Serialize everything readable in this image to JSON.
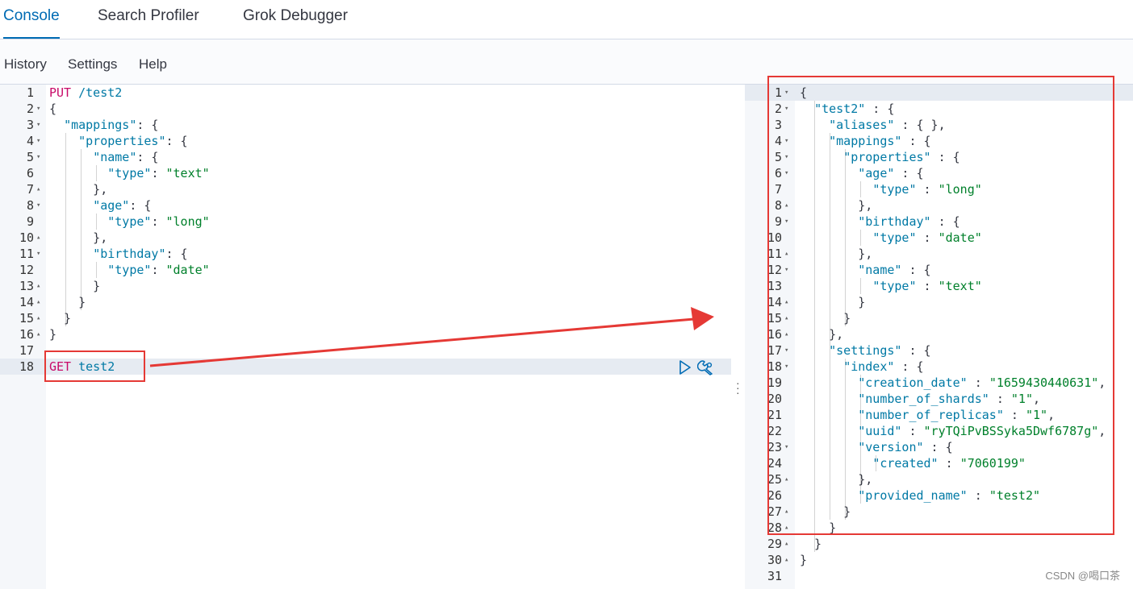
{
  "tabs": [
    {
      "label": "Console",
      "active": true
    },
    {
      "label": "Search Profiler",
      "active": false
    },
    {
      "label": "Grok Debugger",
      "active": false
    }
  ],
  "menu": {
    "history": "History",
    "settings": "Settings",
    "help": "Help"
  },
  "request": {
    "lines": [
      [
        [
          "kw",
          "PUT"
        ],
        [
          "pun",
          " "
        ],
        [
          "path",
          "/test2"
        ]
      ],
      [
        [
          "pun",
          "{"
        ]
      ],
      [
        [
          "pun",
          "  "
        ],
        [
          "key",
          "\"mappings\""
        ],
        [
          "pun",
          ": {"
        ]
      ],
      [
        [
          "pun",
          "    "
        ],
        [
          "key",
          "\"properties\""
        ],
        [
          "pun",
          ": {"
        ]
      ],
      [
        [
          "pun",
          "      "
        ],
        [
          "key",
          "\"name\""
        ],
        [
          "pun",
          ": {"
        ]
      ],
      [
        [
          "pun",
          "        "
        ],
        [
          "key",
          "\"type\""
        ],
        [
          "pun",
          ": "
        ],
        [
          "str",
          "\"text\""
        ]
      ],
      [
        [
          "pun",
          "      },"
        ]
      ],
      [
        [
          "pun",
          "      "
        ],
        [
          "key",
          "\"age\""
        ],
        [
          "pun",
          ": {"
        ]
      ],
      [
        [
          "pun",
          "        "
        ],
        [
          "key",
          "\"type\""
        ],
        [
          "pun",
          ": "
        ],
        [
          "str",
          "\"long\""
        ]
      ],
      [
        [
          "pun",
          "      },"
        ]
      ],
      [
        [
          "pun",
          "      "
        ],
        [
          "key",
          "\"birthday\""
        ],
        [
          "pun",
          ": {"
        ]
      ],
      [
        [
          "pun",
          "        "
        ],
        [
          "key",
          "\"type\""
        ],
        [
          "pun",
          ": "
        ],
        [
          "str",
          "\"date\""
        ]
      ],
      [
        [
          "pun",
          "      }"
        ]
      ],
      [
        [
          "pun",
          "    }"
        ]
      ],
      [
        [
          "pun",
          "  }"
        ]
      ],
      [
        [
          "pun",
          "}"
        ]
      ],
      [],
      [
        [
          "kw",
          "GET"
        ],
        [
          "pun",
          " "
        ],
        [
          "path",
          "test2"
        ]
      ]
    ],
    "folds": [
      "",
      "down",
      "down",
      "down",
      "down",
      "",
      "up",
      "down",
      "",
      "up",
      "down",
      "",
      "up",
      "up",
      "up",
      "up",
      "",
      ""
    ],
    "cursor_line": 18
  },
  "response": {
    "lines": [
      [
        [
          "pun",
          "{"
        ]
      ],
      [
        [
          "pun",
          "  "
        ],
        [
          "key",
          "\"test2\""
        ],
        [
          "pun",
          " : {"
        ]
      ],
      [
        [
          "pun",
          "    "
        ],
        [
          "key",
          "\"aliases\""
        ],
        [
          "pun",
          " : { },"
        ]
      ],
      [
        [
          "pun",
          "    "
        ],
        [
          "key",
          "\"mappings\""
        ],
        [
          "pun",
          " : {"
        ]
      ],
      [
        [
          "pun",
          "      "
        ],
        [
          "key",
          "\"properties\""
        ],
        [
          "pun",
          " : {"
        ]
      ],
      [
        [
          "pun",
          "        "
        ],
        [
          "key",
          "\"age\""
        ],
        [
          "pun",
          " : {"
        ]
      ],
      [
        [
          "pun",
          "          "
        ],
        [
          "key",
          "\"type\""
        ],
        [
          "pun",
          " : "
        ],
        [
          "str",
          "\"long\""
        ]
      ],
      [
        [
          "pun",
          "        },"
        ]
      ],
      [
        [
          "pun",
          "        "
        ],
        [
          "key",
          "\"birthday\""
        ],
        [
          "pun",
          " : {"
        ]
      ],
      [
        [
          "pun",
          "          "
        ],
        [
          "key",
          "\"type\""
        ],
        [
          "pun",
          " : "
        ],
        [
          "str",
          "\"date\""
        ]
      ],
      [
        [
          "pun",
          "        },"
        ]
      ],
      [
        [
          "pun",
          "        "
        ],
        [
          "key",
          "\"name\""
        ],
        [
          "pun",
          " : {"
        ]
      ],
      [
        [
          "pun",
          "          "
        ],
        [
          "key",
          "\"type\""
        ],
        [
          "pun",
          " : "
        ],
        [
          "str",
          "\"text\""
        ]
      ],
      [
        [
          "pun",
          "        }"
        ]
      ],
      [
        [
          "pun",
          "      }"
        ]
      ],
      [
        [
          "pun",
          "    },"
        ]
      ],
      [
        [
          "pun",
          "    "
        ],
        [
          "key",
          "\"settings\""
        ],
        [
          "pun",
          " : {"
        ]
      ],
      [
        [
          "pun",
          "      "
        ],
        [
          "key",
          "\"index\""
        ],
        [
          "pun",
          " : {"
        ]
      ],
      [
        [
          "pun",
          "        "
        ],
        [
          "key",
          "\"creation_date\""
        ],
        [
          "pun",
          " : "
        ],
        [
          "str",
          "\"1659430440631\""
        ],
        [
          "pun",
          ","
        ]
      ],
      [
        [
          "pun",
          "        "
        ],
        [
          "key",
          "\"number_of_shards\""
        ],
        [
          "pun",
          " : "
        ],
        [
          "str",
          "\"1\""
        ],
        [
          "pun",
          ","
        ]
      ],
      [
        [
          "pun",
          "        "
        ],
        [
          "key",
          "\"number_of_replicas\""
        ],
        [
          "pun",
          " : "
        ],
        [
          "str",
          "\"1\""
        ],
        [
          "pun",
          ","
        ]
      ],
      [
        [
          "pun",
          "        "
        ],
        [
          "key",
          "\"uuid\""
        ],
        [
          "pun",
          " : "
        ],
        [
          "str",
          "\"ryTQiPvBSSyka5Dwf6787g\""
        ],
        [
          "pun",
          ","
        ]
      ],
      [
        [
          "pun",
          "        "
        ],
        [
          "key",
          "\"version\""
        ],
        [
          "pun",
          " : {"
        ]
      ],
      [
        [
          "pun",
          "          "
        ],
        [
          "key",
          "\"created\""
        ],
        [
          "pun",
          " : "
        ],
        [
          "str",
          "\"7060199\""
        ]
      ],
      [
        [
          "pun",
          "        },"
        ]
      ],
      [
        [
          "pun",
          "        "
        ],
        [
          "key",
          "\"provided_name\""
        ],
        [
          "pun",
          " : "
        ],
        [
          "str",
          "\"test2\""
        ]
      ],
      [
        [
          "pun",
          "      }"
        ]
      ],
      [
        [
          "pun",
          "    }"
        ]
      ],
      [
        [
          "pun",
          "  }"
        ]
      ],
      [
        [
          "pun",
          "}"
        ]
      ],
      []
    ],
    "folds": [
      "down",
      "down",
      "",
      "down",
      "down",
      "down",
      "",
      "up",
      "down",
      "",
      "up",
      "down",
      "",
      "up",
      "up",
      "up",
      "down",
      "down",
      "",
      "",
      "",
      "",
      "down",
      "",
      "up",
      "",
      "up",
      "up",
      "up",
      "up",
      ""
    ],
    "cursor_line": 1
  },
  "watermark": "CSDN @喝口茶",
  "icons": {
    "run": "play-icon",
    "settings": "wrench-icon"
  },
  "colors": {
    "annotation": "#e53935",
    "accent": "#006bb4"
  }
}
